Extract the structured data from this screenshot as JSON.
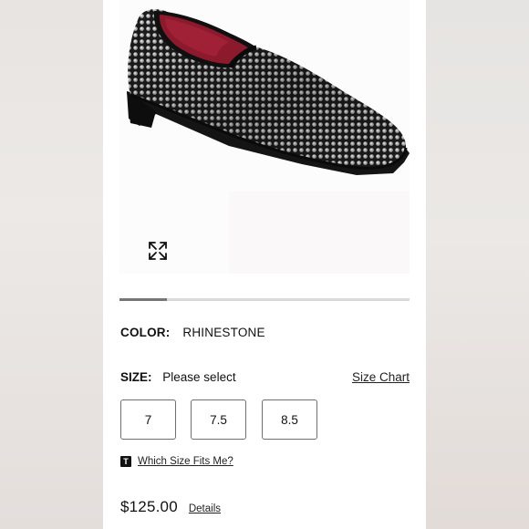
{
  "product": {
    "image_alt": "Black velvet rhinestone loafer",
    "gallery_progress": 0.165
  },
  "color": {
    "label": "COLOR:",
    "value": "RHINESTONE"
  },
  "size": {
    "label": "SIZE:",
    "selected": "Please select",
    "chart_link": "Size Chart",
    "options": [
      "7",
      "7.5",
      "8.5"
    ]
  },
  "fit": {
    "badge": "T",
    "link": "Which Size Fits Me?"
  },
  "price": {
    "amount": "$125.00",
    "details_link": "Details"
  },
  "colors": {
    "accent": "#111111",
    "progress_track": "#d9d9d9",
    "progress_fill": "#767676"
  },
  "icons": {
    "expand": "expand-arrows-icon"
  }
}
